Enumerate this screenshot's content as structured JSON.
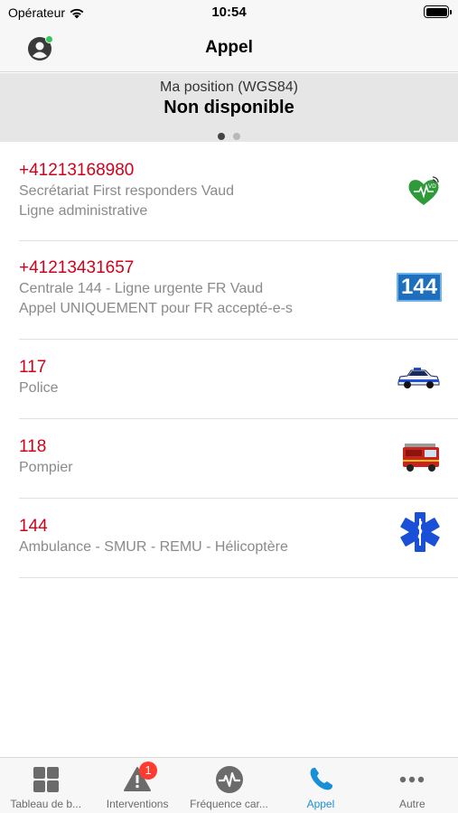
{
  "status_bar": {
    "carrier": "Opérateur",
    "time": "10:54"
  },
  "nav": {
    "title": "Appel"
  },
  "position": {
    "label": "Ma position (WGS84)",
    "value": "Non disponible",
    "page_index": 0,
    "page_count": 2
  },
  "calls": [
    {
      "number": "+41213168980",
      "line1": "Secrétariat First responders Vaud",
      "line2": "Ligne administrative",
      "icon": "heart-icon"
    },
    {
      "number": "+41213431657",
      "line1": "Centrale 144 - Ligne urgente FR Vaud",
      "line2": "Appel UNIQUEMENT pour FR accepté-e-s",
      "icon": "144-logo-icon",
      "icon_text": "144"
    },
    {
      "number": "117",
      "line1": "Police",
      "icon": "police-car-icon"
    },
    {
      "number": "118",
      "line1": "Pompier",
      "icon": "fire-truck-icon"
    },
    {
      "number": "144",
      "line1": "Ambulance - SMUR - REMU - Hélicoptère",
      "icon": "star-of-life-icon"
    }
  ],
  "tabs": [
    {
      "label": "Tableau de b...",
      "icon": "dashboard-icon"
    },
    {
      "label": "Interventions",
      "icon": "warning-icon",
      "badge": "1"
    },
    {
      "label": "Fréquence car...",
      "icon": "heart-rate-icon"
    },
    {
      "label": "Appel",
      "icon": "phone-icon",
      "active": true
    },
    {
      "label": "Autre",
      "icon": "more-icon"
    }
  ],
  "colors": {
    "accent": "#1a8fd6",
    "number_red": "#d0021b",
    "badge": "#ff3b30",
    "online": "#35c759"
  }
}
